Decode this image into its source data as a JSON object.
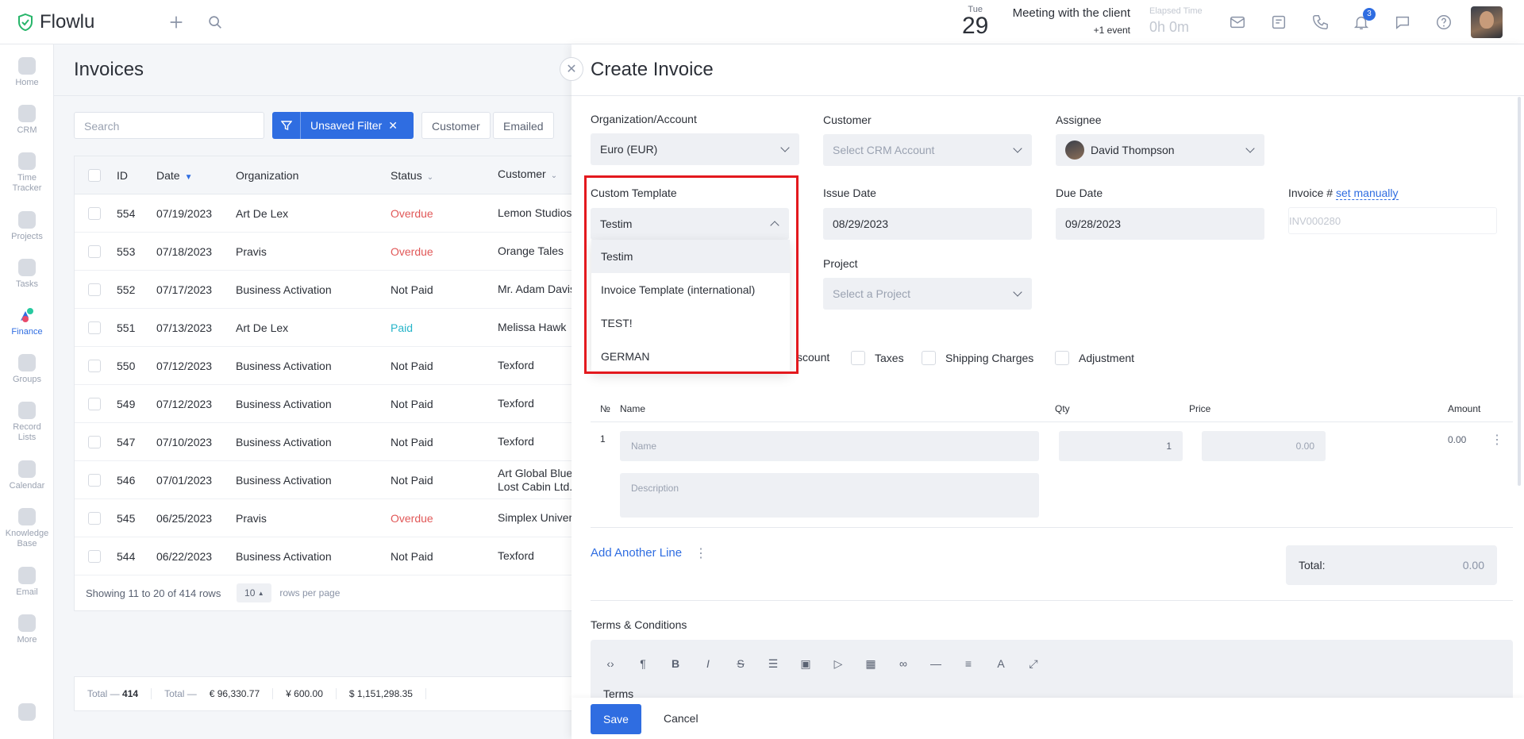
{
  "app": {
    "name": "Flowlu"
  },
  "topbar": {
    "date_dow": "Tue",
    "date_day": "29",
    "meeting_title": "Meeting with the client",
    "meeting_sub": "+1 event",
    "elapsed_label": "Elapsed Time",
    "elapsed_value": "0h 0m",
    "notifications_count": "3"
  },
  "sidebar": {
    "items": [
      {
        "label": "Home"
      },
      {
        "label": "CRM"
      },
      {
        "label": "Time Tracker"
      },
      {
        "label": "Projects"
      },
      {
        "label": "Tasks"
      },
      {
        "label": "Finance"
      },
      {
        "label": "Groups"
      },
      {
        "label": "Record Lists"
      },
      {
        "label": "Calendar"
      },
      {
        "label": "Knowledge Base"
      },
      {
        "label": "Email"
      },
      {
        "label": "More"
      }
    ]
  },
  "invoices": {
    "title": "Invoices",
    "search_placeholder": "Search",
    "filter_label": "Unsaved Filter",
    "chips": [
      "Customer",
      "Emailed"
    ],
    "columns": [
      "ID",
      "Date",
      "Organization",
      "Status",
      "Customer"
    ],
    "rows": [
      {
        "id": "554",
        "date": "07/19/2023",
        "org": "Art De Lex",
        "status": "Overdue",
        "customer": "Lemon Studios"
      },
      {
        "id": "553",
        "date": "07/18/2023",
        "org": "Pravis",
        "status": "Overdue",
        "customer": "Orange Tales"
      },
      {
        "id": "552",
        "date": "07/17/2023",
        "org": "Business Activation",
        "status": "Not Paid",
        "customer": "Mr. Adam Davis"
      },
      {
        "id": "551",
        "date": "07/13/2023",
        "org": "Art De Lex",
        "status": "Paid",
        "customer": "Melissa Hawk"
      },
      {
        "id": "550",
        "date": "07/12/2023",
        "org": "Business Activation",
        "status": "Not Paid",
        "customer": "Texford"
      },
      {
        "id": "549",
        "date": "07/12/2023",
        "org": "Business Activation",
        "status": "Not Paid",
        "customer": "Texford"
      },
      {
        "id": "547",
        "date": "07/10/2023",
        "org": "Business Activation",
        "status": "Not Paid",
        "customer": "Texford"
      },
      {
        "id": "546",
        "date": "07/01/2023",
        "org": "Business Activation",
        "status": "Not Paid",
        "customer": "Art Global Blue",
        "customer2": "Lost Cabin Ltd."
      },
      {
        "id": "545",
        "date": "06/25/2023",
        "org": "Pravis",
        "status": "Overdue",
        "customer": "Simplex Universal"
      },
      {
        "id": "544",
        "date": "06/22/2023",
        "org": "Business Activation",
        "status": "Not Paid",
        "customer": "Texford"
      }
    ],
    "showing": "Showing 11 to 20 of 414 rows",
    "rows_per_page_value": "10",
    "rows_per_page_label": "rows per page",
    "totals": {
      "count_label": "Total —",
      "count": "414",
      "sum_label": "Total —",
      "eur": "€ 96,330.77",
      "jpy": "¥ 600.00",
      "usd": "$ 1,151,298.35"
    }
  },
  "create_invoice": {
    "title": "Create Invoice",
    "org_label": "Organization/Account",
    "org_value": "Euro (EUR)",
    "customer_label": "Customer",
    "customer_placeholder": "Select CRM Account",
    "assignee_label": "Assignee",
    "assignee_value": "David Thompson",
    "template_label": "Custom Template",
    "template_value": "Testim",
    "template_options": [
      "Testim",
      "Invoice Template (international)",
      "TEST!",
      "GERMAN"
    ],
    "issue_label": "Issue Date",
    "issue_value": "08/29/2023",
    "due_label": "Due Date",
    "due_value": "09/28/2023",
    "invoice_no_label": "Invoice #",
    "invoice_no_link": "set manually",
    "invoice_no_placeholder": "INV000280",
    "project_label": "Project",
    "project_placeholder": "Select a Project",
    "checks": [
      "scount",
      "Taxes",
      "Shipping Charges",
      "Adjustment"
    ],
    "item_cols": {
      "no": "№",
      "name": "Name",
      "qty": "Qty",
      "price": "Price",
      "amount": "Amount"
    },
    "line": {
      "no": "1",
      "name_placeholder": "Name",
      "qty": "1",
      "price": "0.00",
      "amount": "0.00",
      "desc_placeholder": "Description"
    },
    "add_line": "Add Another Line",
    "total_label": "Total:",
    "total_value": "0.00",
    "terms_label": "Terms & Conditions",
    "terms_text": "Terms",
    "save": "Save",
    "cancel": "Cancel"
  },
  "colors": {
    "accent": "#2f6de1",
    "overdue": "#e15858",
    "paid": "#27b5c9",
    "highlight": "#e3191e"
  }
}
